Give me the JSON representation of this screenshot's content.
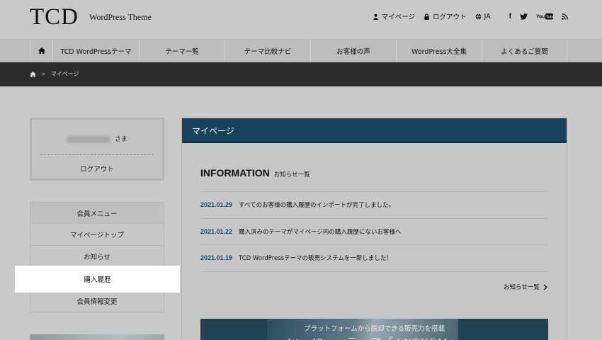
{
  "header": {
    "logo": "TCD",
    "logo_sub": "WordPress Theme",
    "links": [
      {
        "label": "マイページ",
        "icon": "person-icon"
      },
      {
        "label": "ログアウト",
        "icon": "lock-icon"
      },
      {
        "label": "JA",
        "icon": "globe-icon"
      }
    ],
    "social": [
      {
        "label": "f",
        "icon": "facebook-icon"
      },
      {
        "label": "🐦",
        "icon": "twitter-icon"
      },
      {
        "label": "YouTube",
        "icon": "youtube-icon"
      },
      {
        "label": "RSS",
        "icon": "rss-icon"
      }
    ]
  },
  "nav": {
    "home_icon": "home-icon",
    "items": [
      "TCD WordPressテーマ",
      "テーマ一覧",
      "テーマ比較ナビ",
      "お客様の声",
      "WordPress大全集",
      "よくあるご質問"
    ]
  },
  "breadcrumb": {
    "current": "マイページ",
    "separator": ">"
  },
  "sidebar": {
    "name_suffix": "さま",
    "logout": "ログアウト",
    "menu_title": "会員メニュー",
    "menu_items": [
      "マイページトップ",
      "お知らせ",
      "購入履歴",
      "会員情報変更"
    ],
    "active_index": 2
  },
  "main": {
    "panel_title": "マイページ",
    "info_title_en": "INFORMATION",
    "info_title_ja": "お知らせ一覧",
    "news": [
      {
        "date": "2021.01.29",
        "text": "すべてのお客様の購入履歴のインポートが完了しました。"
      },
      {
        "date": "2021.01.22",
        "text": "購入済みのテーマがマイページ内の購入履歴にないお客様へ"
      },
      {
        "date": "2021.01.19",
        "text": "TCD WordPressテーマの販売システムを一新しました！"
      }
    ],
    "more_link": "お知らせ一覧",
    "banner_line1": "プラットフォームから脱却できる販売力を搭載",
    "banner_line2": "WordPressテーマ「ANTHEM」"
  },
  "colors": {
    "panel_header": "#16435a",
    "date_text": "#1f4a63",
    "breadcrumb_bg": "#2c2c2c"
  }
}
